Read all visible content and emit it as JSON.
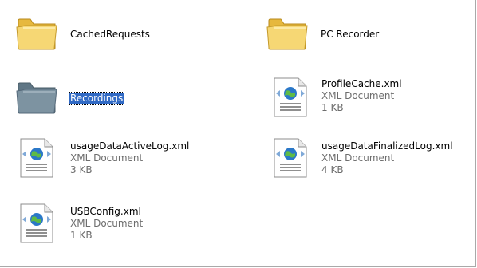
{
  "colors": {
    "folder_yellow": "#f3cf62",
    "folder_gray": "#748b9a",
    "selection": "#316ac5",
    "xml_globe": "#2b78c8"
  },
  "items": [
    {
      "name": "CachedRequests",
      "type": "",
      "size": "",
      "icon": "folder-icon"
    },
    {
      "name": "PC Recorder",
      "type": "",
      "size": "",
      "icon": "folder-icon"
    },
    {
      "name": "Recordings",
      "type": "",
      "size": "",
      "icon": "folder-icon",
      "selected": true
    },
    {
      "name": "ProfileCache.xml",
      "type": "XML Document",
      "size": "1 KB",
      "icon": "xml-file-icon"
    },
    {
      "name": "usageDataActiveLog.xml",
      "type": "XML Document",
      "size": "3 KB",
      "icon": "xml-file-icon"
    },
    {
      "name": "usageDataFinalizedLog.xml",
      "type": "XML Document",
      "size": "4 KB",
      "icon": "xml-file-icon"
    },
    {
      "name": "USBConfig.xml",
      "type": "XML Document",
      "size": "1 KB",
      "icon": "xml-file-icon"
    }
  ]
}
